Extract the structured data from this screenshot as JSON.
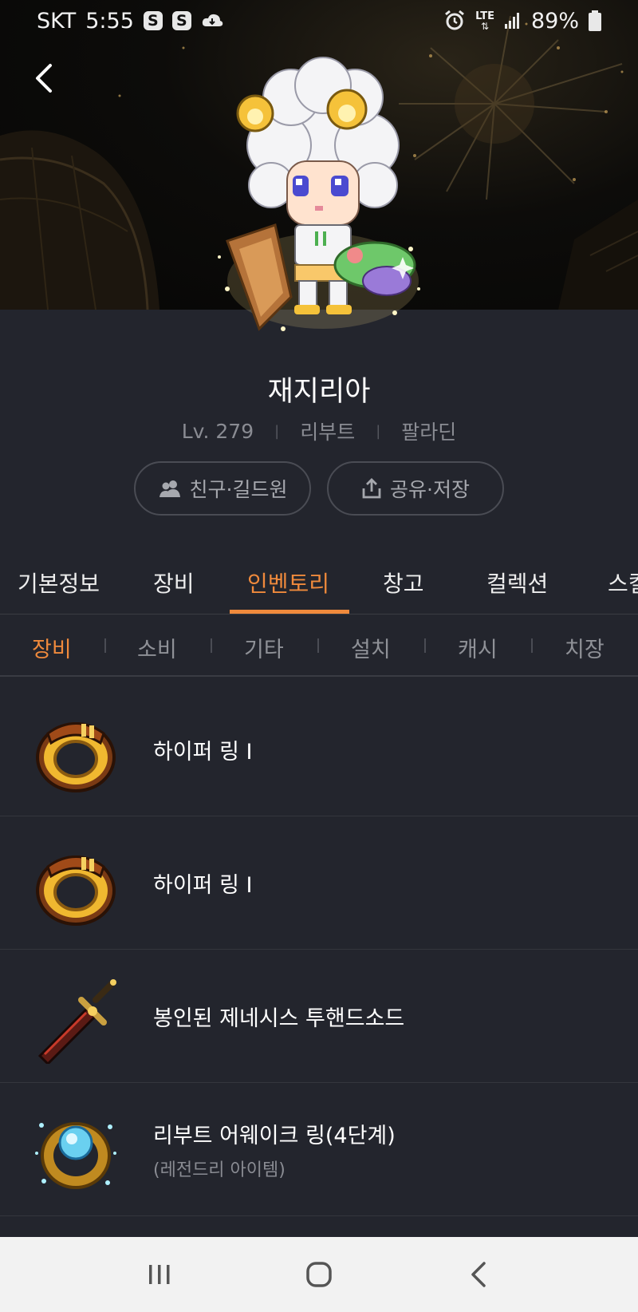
{
  "status_bar": {
    "carrier": "SKT",
    "time": "5:55",
    "s_badges": [
      "S",
      "S"
    ],
    "network": "LTE",
    "battery": "89%"
  },
  "profile": {
    "name": "재지리아",
    "level": "Lv. 279",
    "world": "리부트",
    "job": "팔라딘",
    "friends_button": "친구·길드원",
    "share_button": "공유·저장"
  },
  "main_tabs": [
    "기본정보",
    "장비",
    "인벤토리",
    "창고",
    "컬렉션",
    "스킬"
  ],
  "main_tab_active": "인벤토리",
  "sub_tabs": [
    "장비",
    "소비",
    "기타",
    "설치",
    "캐시",
    "치장"
  ],
  "sub_tab_active": "장비",
  "items": [
    {
      "name": "하이퍼 링 I",
      "icon": "ring-icon"
    },
    {
      "name": "하이퍼 링 I",
      "icon": "ring-icon"
    },
    {
      "name": "봉인된 제네시스 투핸드소드",
      "icon": "sword-icon"
    },
    {
      "name": "리부트 어웨이크 링(4단계)",
      "sub": "(레전드리 아이템)",
      "icon": "awake-ring-icon"
    }
  ],
  "colors": {
    "background": "#23252d",
    "accent": "#f08a3c",
    "muted_text": "#8a8c93",
    "nav_bar": "#f2f2f2"
  }
}
